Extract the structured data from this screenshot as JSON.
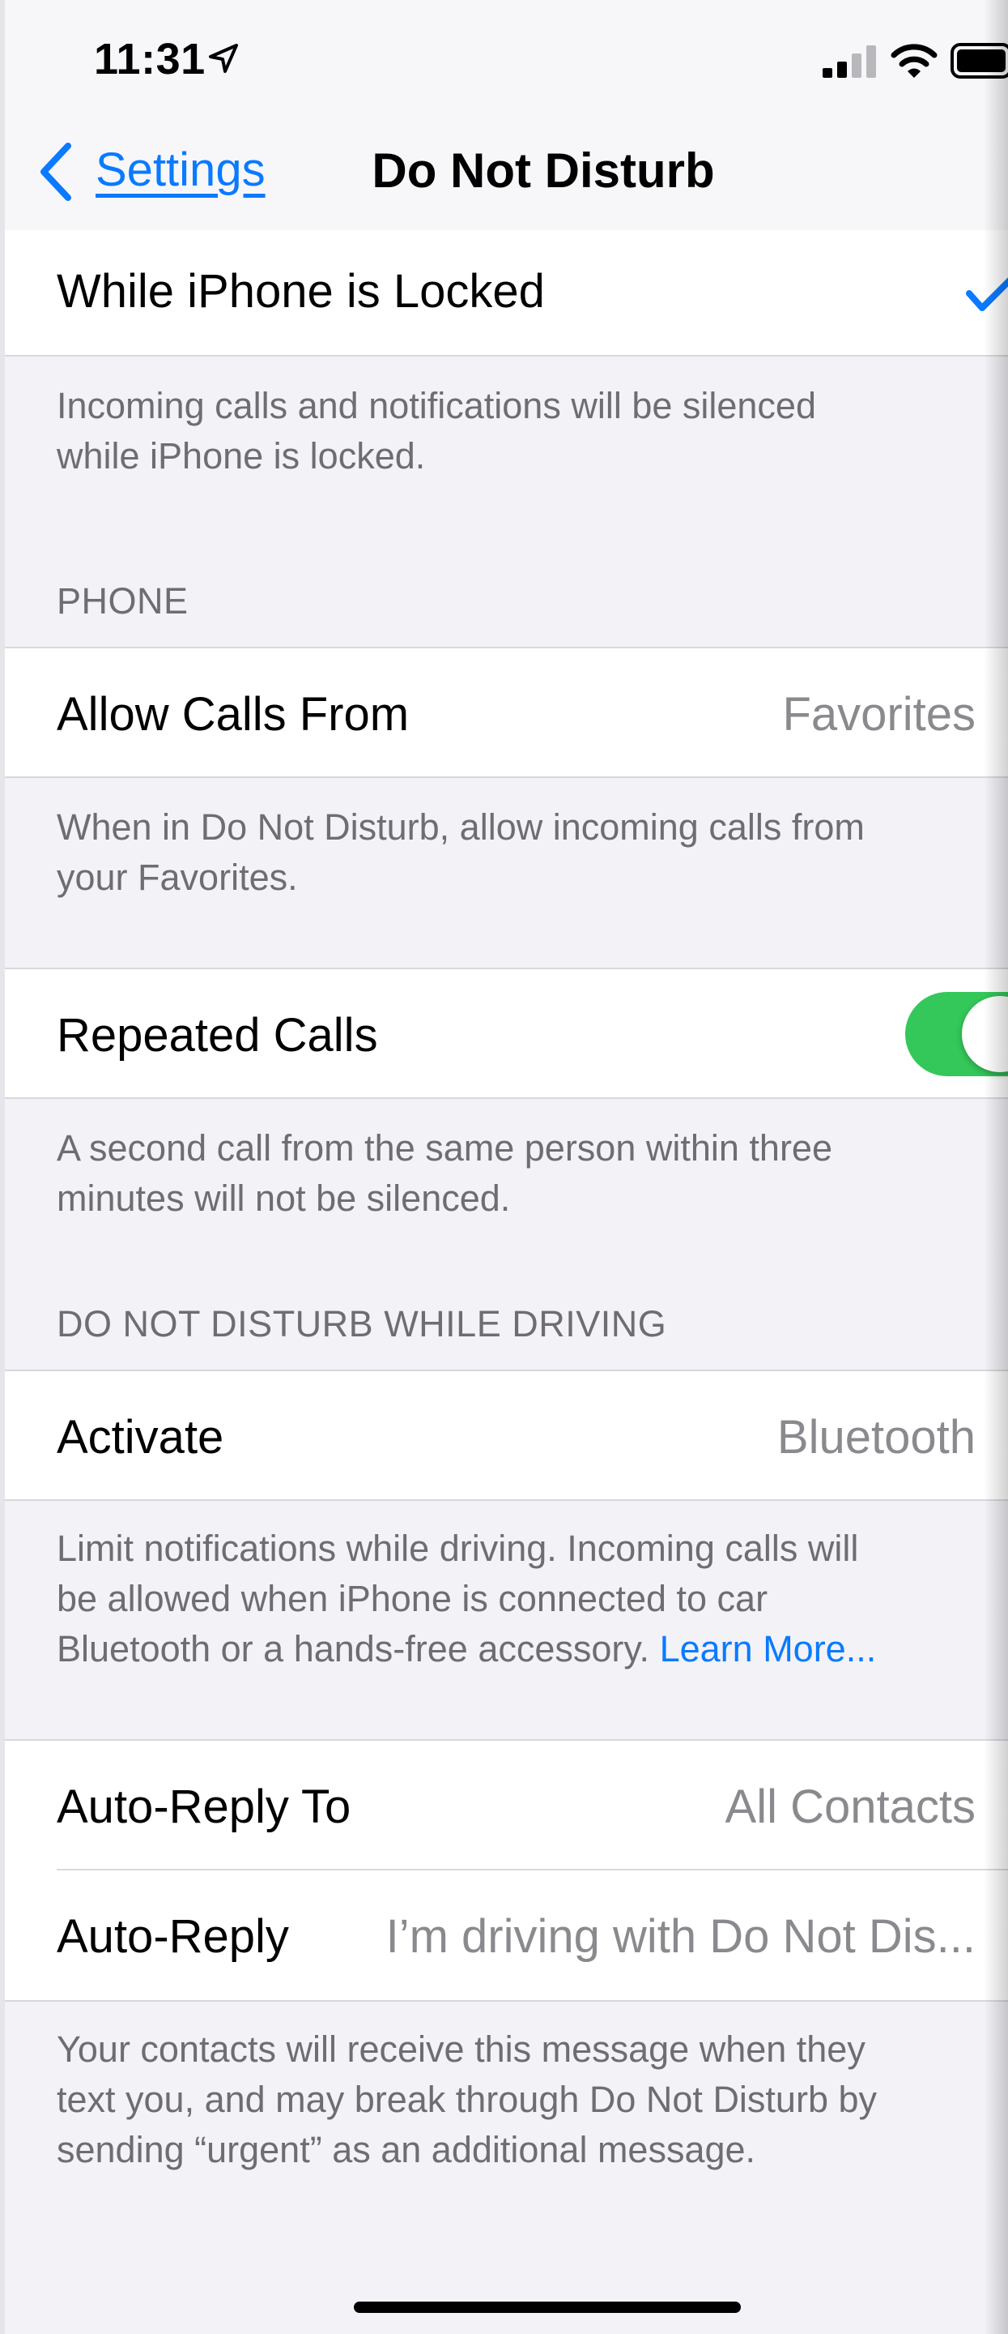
{
  "status_bar": {
    "time": "11:31"
  },
  "nav": {
    "back_label": "Settings",
    "title": "Do Not Disturb"
  },
  "sections": {
    "locked_row": {
      "label": "While iPhone is Locked"
    },
    "locked_footer": {
      "line1": "Incoming calls and notifications will be silenced",
      "line2": "while iPhone is locked."
    },
    "phone_header": "PHONE",
    "allow_calls": {
      "label": "Allow Calls From",
      "value": "Favorites"
    },
    "allow_calls_footer": {
      "line1": "When in Do Not Disturb, allow incoming calls from",
      "line2": "your Favorites."
    },
    "repeated_calls": {
      "label": "Repeated Calls",
      "toggle_on": true
    },
    "repeated_calls_footer": {
      "line1": "A second call from the same person within three",
      "line2": "minutes will not be silenced."
    },
    "driving_header": "DO NOT DISTURB WHILE DRIVING",
    "activate": {
      "label": "Activate",
      "value": "Bluetooth"
    },
    "activate_footer": {
      "line1": "Limit notifications while driving. Incoming calls will",
      "line2": "be allowed when iPhone is connected to car",
      "line3": "Bluetooth or a hands-free accessory.",
      "learn_more": "Learn More..."
    },
    "auto_reply_to": {
      "label": "Auto-Reply To",
      "value": "All Contacts"
    },
    "auto_reply": {
      "label": "Auto-Reply",
      "value": "I’m driving with Do Not Dis..."
    },
    "auto_reply_footer": {
      "line1": "Your contacts will receive this message when they",
      "line2": "text you, and may break through Do Not Disturb by",
      "line3": "sending “urgent” as an additional message."
    }
  },
  "colors": {
    "accent": "#0a7aff",
    "toggle_on": "#34c759",
    "background": "#f2f2f7"
  }
}
